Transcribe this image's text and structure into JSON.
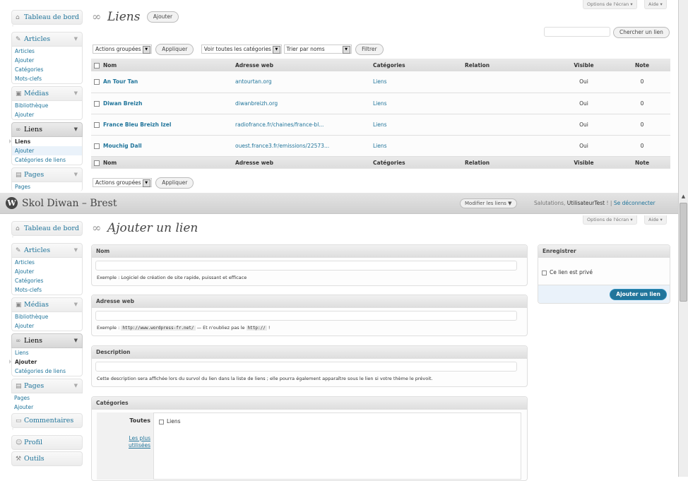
{
  "top": {
    "sidebar": {
      "dashboard": "Tableau de bord",
      "articles": {
        "label": "Articles",
        "items": [
          "Articles",
          "Ajouter",
          "Catégories",
          "Mots-clefs"
        ]
      },
      "medias": {
        "label": "Médias",
        "items": [
          "Bibliothèque",
          "Ajouter"
        ]
      },
      "liens": {
        "label": "Liens",
        "items": [
          "Liens",
          "Ajouter",
          "Catégories de liens"
        ]
      },
      "pages": {
        "label": "Pages",
        "items": [
          "Pages"
        ]
      }
    },
    "title": "Liens",
    "add_button": "Ajouter",
    "screen_options": "Options de l'écran",
    "help": "Aide",
    "search_button": "Chercher un lien",
    "bulk_actions": "Actions groupées",
    "apply": "Appliquer",
    "category_filter": "Voir toutes les catégories",
    "sort_by": "Trier par noms",
    "filter": "Filtrer",
    "columns": [
      "Nom",
      "Adresse web",
      "Catégories",
      "Relation",
      "Visible",
      "Note"
    ],
    "rows": [
      {
        "name": "An Tour Tan",
        "url": "antourtan.org",
        "category": "Liens",
        "relation": "",
        "visible": "Oui",
        "rating": "0"
      },
      {
        "name": "Diwan Breizh",
        "url": "diwanbreizh.org",
        "category": "Liens",
        "relation": "",
        "visible": "Oui",
        "rating": "0"
      },
      {
        "name": "France Bleu Breizh Izel",
        "url": "radiofrance.fr/chaines/france-bl...",
        "category": "Liens",
        "relation": "",
        "visible": "Oui",
        "rating": "0"
      },
      {
        "name": "Mouchig Dall",
        "url": "ouest.france3.fr/emissions/22573...",
        "category": "Liens",
        "relation": "",
        "visible": "Oui",
        "rating": "0"
      }
    ]
  },
  "adminbar": {
    "site_name": "Skol Diwan – Brest",
    "favorite": "Modifier les liens",
    "greeting_prefix": "Salutations,",
    "user": "UtilisateurTest",
    "separator": "! |",
    "logout": "Se déconnecter"
  },
  "bottom": {
    "sidebar": {
      "dashboard": "Tableau de bord",
      "articles": {
        "label": "Articles",
        "items": [
          "Articles",
          "Ajouter",
          "Catégories",
          "Mots-clefs"
        ]
      },
      "medias": {
        "label": "Médias",
        "items": [
          "Bibliothèque",
          "Ajouter"
        ]
      },
      "liens": {
        "label": "Liens",
        "items": [
          "Liens",
          "Ajouter",
          "Catégories de liens"
        ]
      },
      "pages": {
        "label": "Pages",
        "items": [
          "Pages",
          "Ajouter"
        ]
      },
      "comments": "Commentaires",
      "profile": "Profil",
      "tools": "Outils"
    },
    "title": "Ajouter un lien",
    "screen_options": "Options de l'écran",
    "help": "Aide",
    "name_box": {
      "title": "Nom",
      "hint": "Exemple : Logiciel de création de site rapide, puissant et efficace"
    },
    "url_box": {
      "title": "Adresse web",
      "hint_prefix": "Exemple :",
      "hint_code": "http://www.wordpress-fr.net/",
      "hint_mid": "— Et n'oubliez pas le",
      "hint_code2": "http://",
      "hint_end": "!"
    },
    "desc_box": {
      "title": "Description",
      "hint": "Cette description sera affichée lors du survol du lien dans la liste de liens ; elle pourra également apparaître sous le lien si votre thème le prévoit."
    },
    "cat_box": {
      "title": "Catégories",
      "tab_all": "Toutes",
      "tab_popular": "Les plus utilisées",
      "option": "Liens"
    },
    "save_box": {
      "title": "Enregistrer",
      "private": "Ce lien est privé",
      "submit": "Ajouter un lien"
    }
  }
}
